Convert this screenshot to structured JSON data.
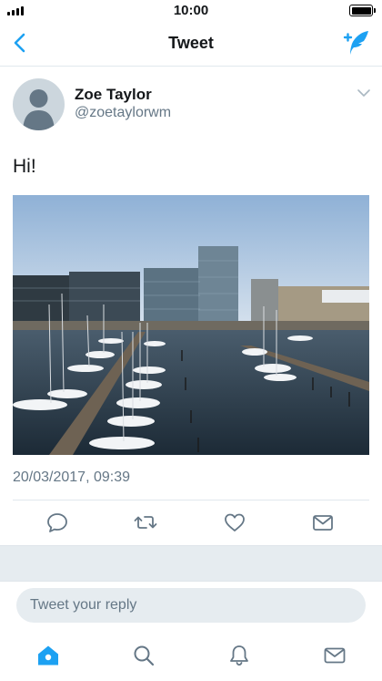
{
  "status": {
    "time": "10:00"
  },
  "nav": {
    "title": "Tweet"
  },
  "tweet": {
    "author_name": "Zoe Taylor",
    "author_handle": "@zoetaylorwm",
    "text": "Hi!",
    "timestamp": "20/03/2017, 09:39"
  },
  "reply": {
    "placeholder": "Tweet your reply"
  },
  "icons": {
    "back": "chevron-left-icon",
    "compose": "compose-feather-icon",
    "caret": "chevron-down-icon",
    "reply": "speech-bubble-icon",
    "retweet": "retweet-icon",
    "like": "heart-icon",
    "dm": "envelope-icon",
    "home": "home-icon",
    "search": "search-icon",
    "notifications": "bell-icon",
    "messages": "envelope-icon"
  },
  "colors": {
    "accent": "#1da1f2",
    "muted": "#657786",
    "text": "#14171a",
    "separator": "#e1e8ed"
  }
}
